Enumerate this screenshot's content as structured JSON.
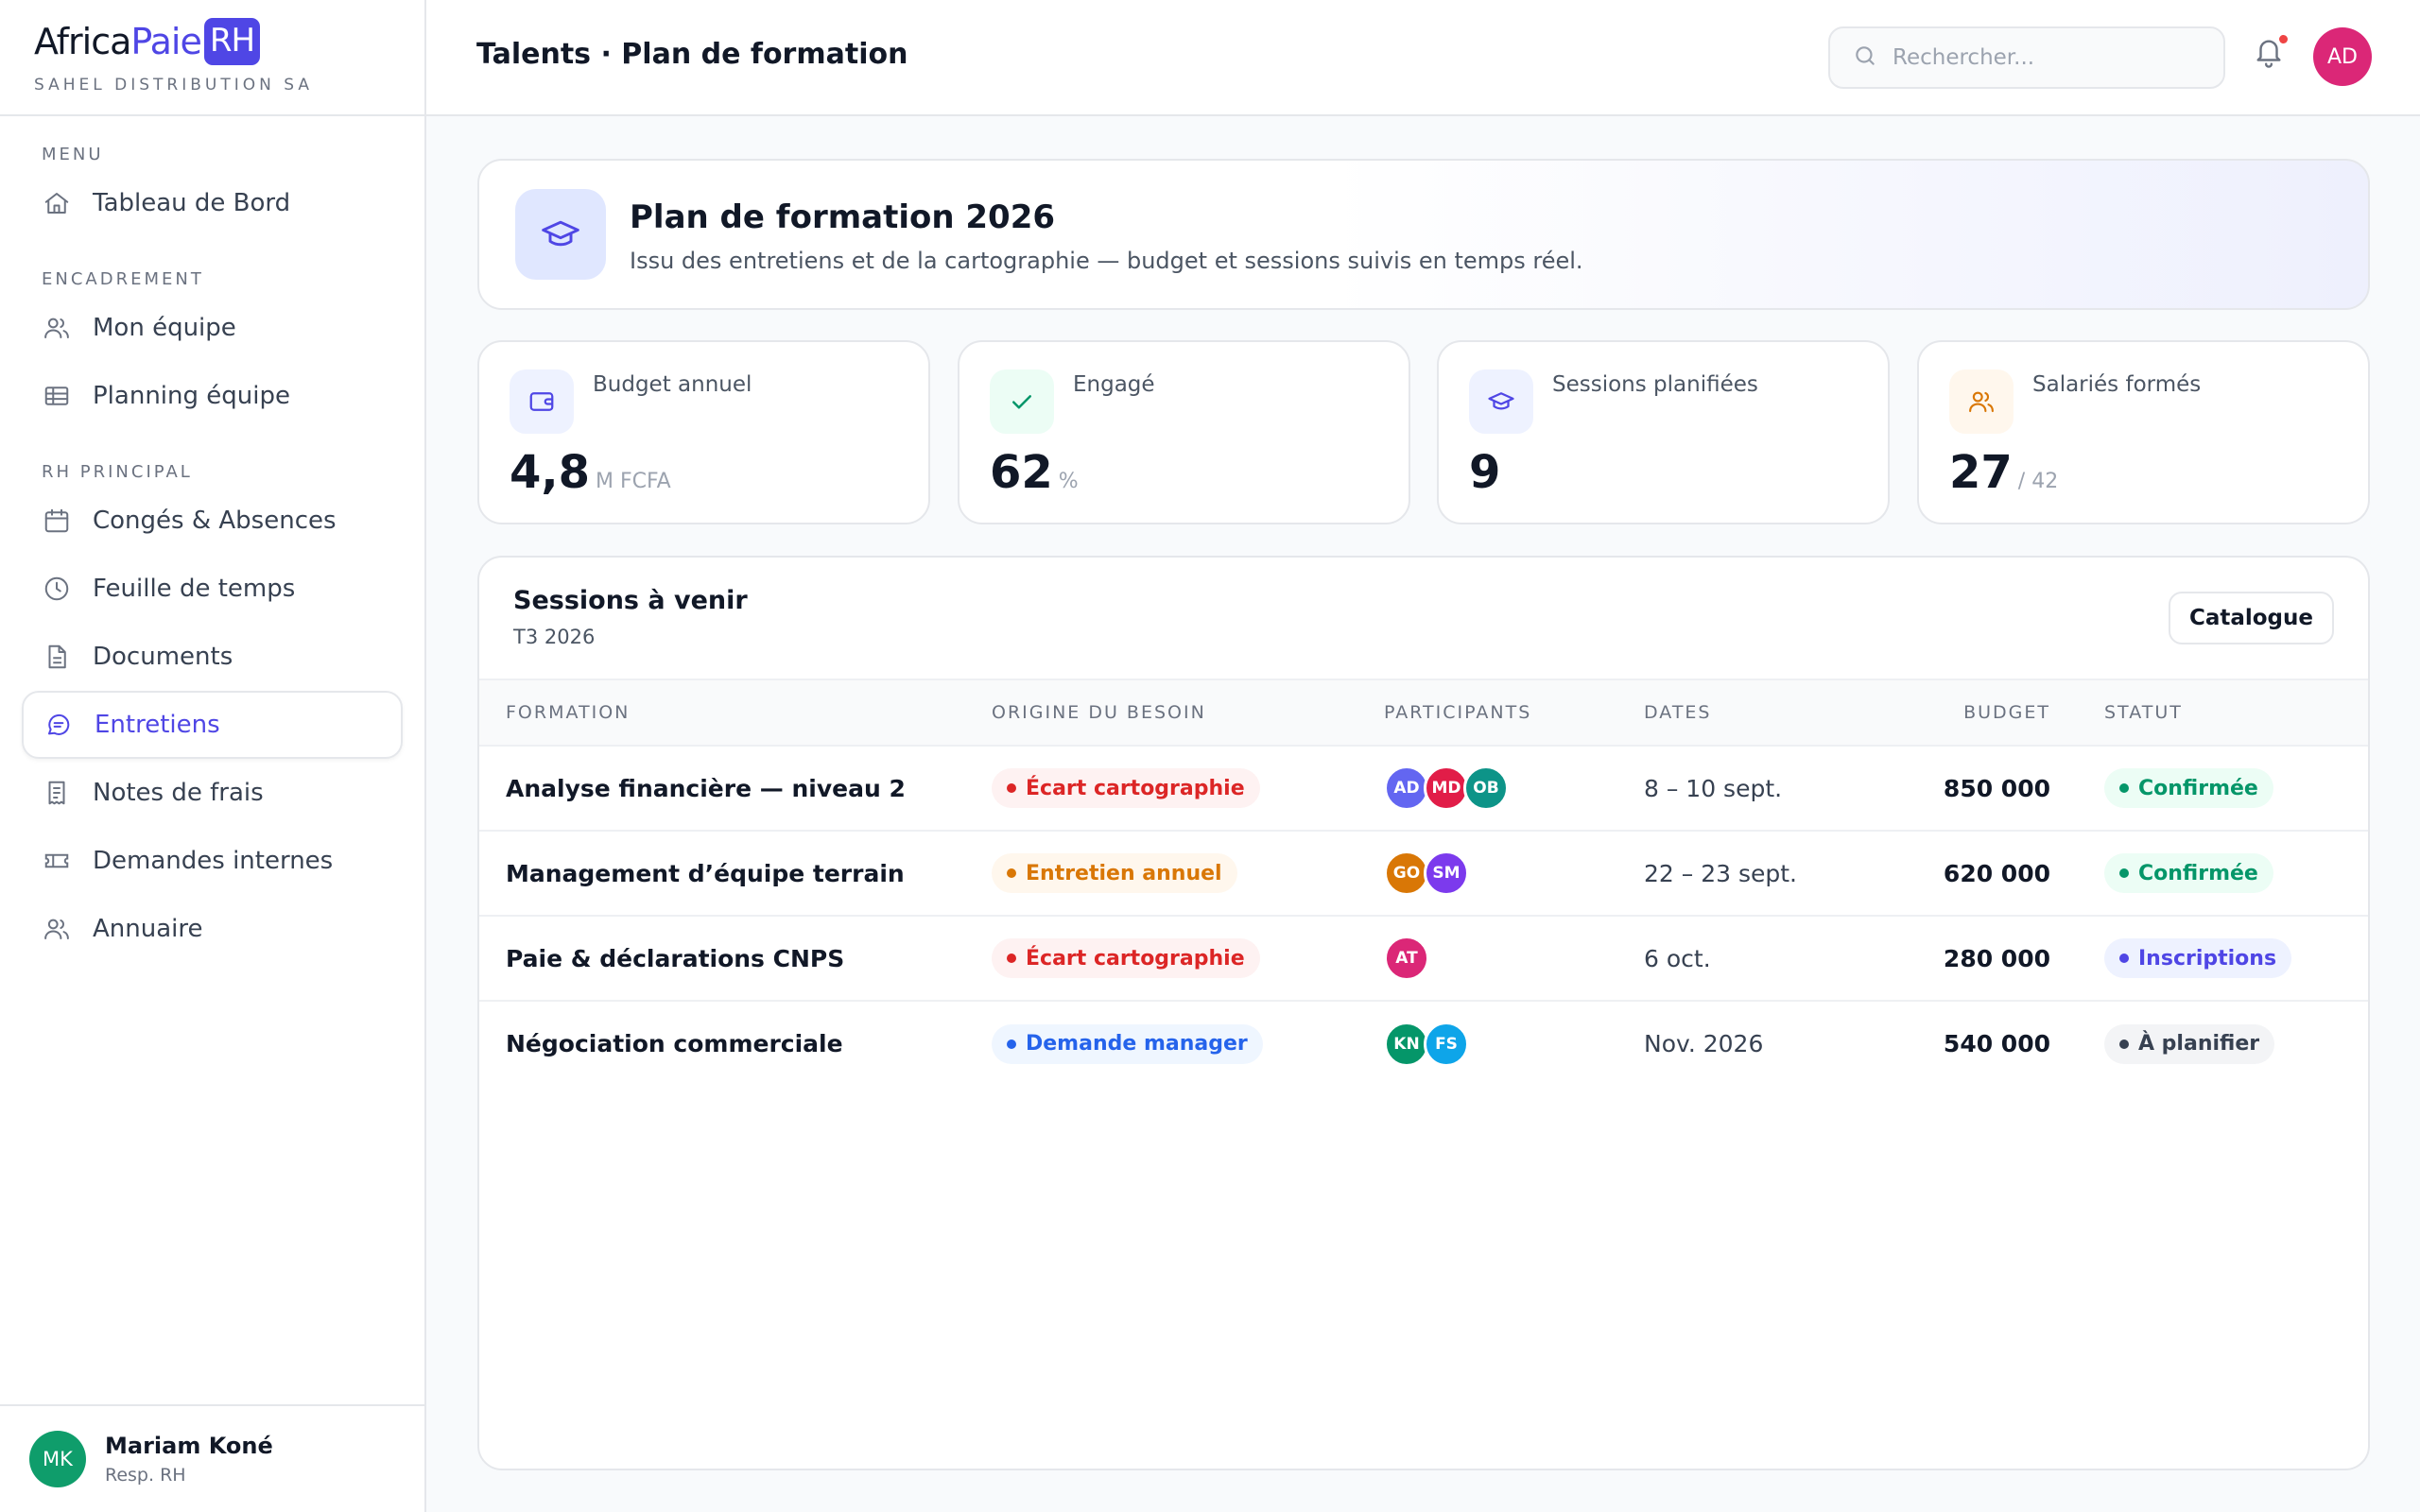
{
  "brand": {
    "part1": "Africa",
    "part2": "Paie",
    "badge": "RH",
    "company": "SAHEL DISTRIBUTION SA"
  },
  "nav": {
    "sections": [
      "MENU",
      "ENCADREMENT",
      "RH PRINCIPAL"
    ],
    "items": [
      {
        "label": "Tableau de Bord",
        "icon": "home-icon"
      },
      {
        "label": "Mon équipe",
        "icon": "users-icon"
      },
      {
        "label": "Planning équipe",
        "icon": "table-icon"
      },
      {
        "label": "Congés & Absences",
        "icon": "calendar-icon"
      },
      {
        "label": "Feuille de temps",
        "icon": "clock-icon"
      },
      {
        "label": "Documents",
        "icon": "document-icon"
      },
      {
        "label": "Entretiens",
        "icon": "chat-icon",
        "active": true
      },
      {
        "label": "Notes de frais",
        "icon": "receipt-icon"
      },
      {
        "label": "Demandes internes",
        "icon": "ticket-icon"
      },
      {
        "label": "Annuaire",
        "icon": "users-icon"
      }
    ]
  },
  "user": {
    "initials": "MK",
    "name": "Mariam Koné",
    "role": "Resp. RH"
  },
  "topbar": {
    "breadcrumb": "Talents · Plan de formation",
    "search_placeholder": "Rechercher...",
    "avatar": "AD"
  },
  "hero": {
    "title": "Plan de formation 2026",
    "subtitle": "Issu des entretiens et de la cartographie — budget et sessions suivis en temps réel.",
    "icon": "graduation-cap-icon"
  },
  "kpis": [
    {
      "label": "Budget annuel",
      "value": "4,8",
      "unit": "M FCFA",
      "icon": "wallet-icon",
      "color": "#4f46e5"
    },
    {
      "label": "Engagé",
      "value": "62",
      "unit": "%",
      "icon": "check-icon",
      "color": "#059669"
    },
    {
      "label": "Sessions planifiées",
      "value": "9",
      "unit": "",
      "icon": "graduation-cap-icon",
      "color": "#4f46e5"
    },
    {
      "label": "Salariés formés",
      "value": "27",
      "unit": "/ 42",
      "icon": "users-icon",
      "color": "#d97706"
    }
  ],
  "sessions": {
    "title": "Sessions à venir",
    "subtitle": "T3 2026",
    "catalog_label": "Catalogue",
    "columns": [
      "FORMATION",
      "ORIGINE DU BESOIN",
      "PARTICIPANTS",
      "DATES",
      "BUDGET",
      "STATUT"
    ],
    "rows": [
      {
        "formation": "Analyse financière — niveau 2",
        "origin": "Écart cartographie",
        "origin_tone": "red",
        "participants": [
          {
            "i": "AD",
            "c": "#6366f1"
          },
          {
            "i": "MD",
            "c": "#e11d48"
          },
          {
            "i": "OB",
            "c": "#0d9488"
          }
        ],
        "dates": "8 – 10 sept.",
        "budget": "850 000",
        "status": "Confirmée",
        "status_tone": "green"
      },
      {
        "formation": "Management d’équipe terrain",
        "origin": "Entretien annuel",
        "origin_tone": "orange",
        "participants": [
          {
            "i": "GO",
            "c": "#d97706"
          },
          {
            "i": "SM",
            "c": "#7c3aed"
          }
        ],
        "dates": "22 – 23 sept.",
        "budget": "620 000",
        "status": "Confirmée",
        "status_tone": "green"
      },
      {
        "formation": "Paie & déclarations CNPS",
        "origin": "Écart cartographie",
        "origin_tone": "red",
        "participants": [
          {
            "i": "AT",
            "c": "#db2777"
          }
        ],
        "dates": "6 oct.",
        "budget": "280 000",
        "status": "Inscriptions",
        "status_tone": "violet"
      },
      {
        "formation": "Négociation commerciale",
        "origin": "Demande manager",
        "origin_tone": "blue",
        "participants": [
          {
            "i": "KN",
            "c": "#059669"
          },
          {
            "i": "FS",
            "c": "#0ea5e9"
          }
        ],
        "dates": "Nov. 2026",
        "budget": "540 000",
        "status": "À planifier",
        "status_tone": "gray"
      }
    ]
  }
}
